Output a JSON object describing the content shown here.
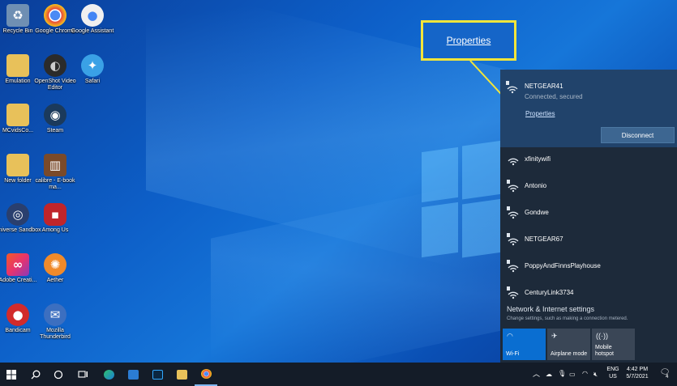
{
  "desktop": {
    "icons": [
      {
        "label": "Recycle Bin",
        "icon": "recycle-bin-icon",
        "color": "#6f8fb3"
      },
      {
        "label": "Google Chrome",
        "icon": "chrome-icon",
        "color": "#e8463a"
      },
      {
        "label": "Google Assistant",
        "icon": "google-assistant-icon",
        "color": "#f0f0f0"
      },
      {
        "label": "Emulation",
        "icon": "folder-icon",
        "color": "#e8c15a"
      },
      {
        "label": "OpenShot Video Editor",
        "icon": "openshot-icon",
        "color": "#2b2b2b"
      },
      {
        "label": "Safari",
        "icon": "safari-icon",
        "color": "#3aa1e6"
      },
      {
        "label": "MCvidsCo...",
        "icon": "folder-icon",
        "color": "#e8c15a"
      },
      {
        "label": "Steam",
        "icon": "steam-icon",
        "color": "#1b3a5c"
      },
      {
        "label": "New folder",
        "icon": "folder-icon",
        "color": "#e8c15a"
      },
      {
        "label": "calibre - E-book ma...",
        "icon": "calibre-icon",
        "color": "#7a4a2a"
      },
      {
        "label": "Universe Sandbox",
        "icon": "universe-sandbox-icon",
        "color": "#2a3f6e"
      },
      {
        "label": "Among Us",
        "icon": "among-us-icon",
        "color": "#c0252b"
      },
      {
        "label": "Adobe Creati...",
        "icon": "adobe-cc-icon",
        "color": "#e8336d"
      },
      {
        "label": "Aether",
        "icon": "aether-icon",
        "color": "#f08a2a"
      },
      {
        "label": "Bandicam",
        "icon": "bandicam-icon",
        "color": "#d22b2b"
      },
      {
        "label": "Mozilla Thunderbird",
        "icon": "thunderbird-icon",
        "color": "#3c6fc0"
      }
    ]
  },
  "callout": {
    "label": "Properties",
    "border_color": "#f3e53a"
  },
  "wifi_panel": {
    "active": {
      "name": "NETGEAR41",
      "status": "Connected, secured",
      "properties_link": "Properties",
      "disconnect_label": "Disconnect"
    },
    "networks": [
      "xfinitywifi",
      "Antonio",
      "Gondwe",
      "NETGEAR67",
      "PoppyAndFinnsPlayhouse",
      "CenturyLink3734"
    ],
    "settings_title": "Network & Internet settings",
    "settings_subtitle": "Change settings, such as making a connection metered.",
    "quick_actions": [
      {
        "label": "Wi-Fi",
        "icon": "wifi-icon",
        "active": true
      },
      {
        "label": "Airplane mode",
        "icon": "airplane-icon",
        "active": false
      },
      {
        "label": "Mobile hotspot",
        "icon": "hotspot-icon",
        "active": false
      }
    ]
  },
  "taskbar": {
    "language": "ENG",
    "region": "US",
    "time": "4:42 PM",
    "date": "5/7/2021",
    "notification_count": "4"
  },
  "colors": {
    "panel_bg": "#1d2a3a",
    "active_network_bg": "#21436b",
    "accent": "#0a6ed1",
    "taskbar_bg": "#141c28"
  }
}
